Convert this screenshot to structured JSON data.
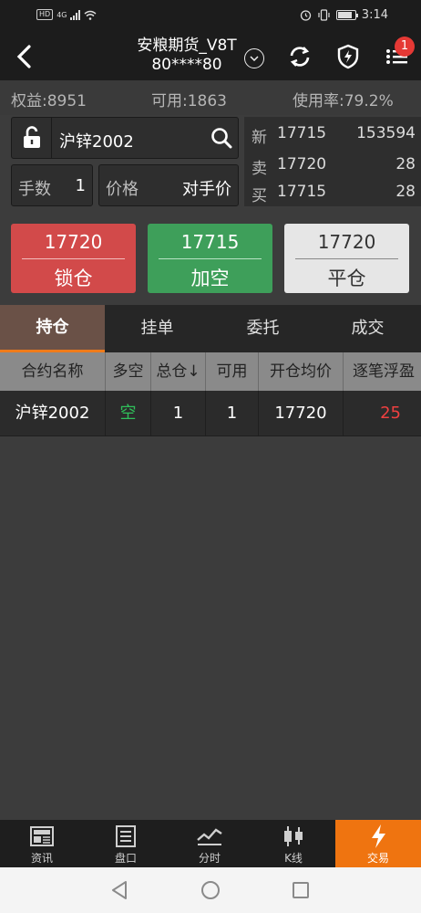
{
  "status_bar": {
    "hd": "HD",
    "network": "4G",
    "time": "3:14"
  },
  "header": {
    "title_line1": "安粮期货_V8T",
    "title_line2": "80****80",
    "notification_count": "1",
    "icons": [
      "back-icon",
      "chevron-down-icon",
      "refresh-icon",
      "shield-bolt-icon",
      "menu-icon"
    ]
  },
  "summary": {
    "equity": "权益:8951",
    "available": "可用:1863",
    "usage": "使用率:79.2%"
  },
  "order_form": {
    "contract": "沪锌2002",
    "qty_label": "手数",
    "qty_value": "1",
    "price_label": "价格",
    "price_value": "对手价"
  },
  "quote": {
    "last_label": "新",
    "last_price": "17715",
    "last_volume": "153594",
    "ask_label": "卖",
    "ask_price": "17720",
    "ask_volume": "28",
    "bid_label": "买",
    "bid_price": "17715",
    "bid_volume": "28"
  },
  "actions": {
    "lock_price": "17720",
    "lock_label": "锁仓",
    "short_price": "17715",
    "short_label": "加空",
    "close_price": "17720",
    "close_label": "平仓"
  },
  "tabs": [
    "持仓",
    "挂单",
    "委托",
    "成交"
  ],
  "table": {
    "headers": [
      "合约名称",
      "多空",
      "总仓↓",
      "可用",
      "开仓均价",
      "逐笔浮盈"
    ],
    "rows": [
      {
        "contract": "沪锌2002",
        "side": "空",
        "total": "1",
        "available": "1",
        "avg_price": "17720",
        "pnl": "25"
      }
    ]
  },
  "bottom_nav": [
    {
      "label": "资讯",
      "icon": "news-icon"
    },
    {
      "label": "盘口",
      "icon": "orderbook-icon"
    },
    {
      "label": "分时",
      "icon": "timeshare-icon"
    },
    {
      "label": "K线",
      "icon": "candlestick-icon"
    },
    {
      "label": "交易",
      "icon": "lightning-icon"
    }
  ],
  "colors": {
    "accent": "#ef7410",
    "up": "#d24a4a",
    "down": "#3e9f5a",
    "pnl": "#ef4040",
    "short_side": "#2fbf5a"
  }
}
